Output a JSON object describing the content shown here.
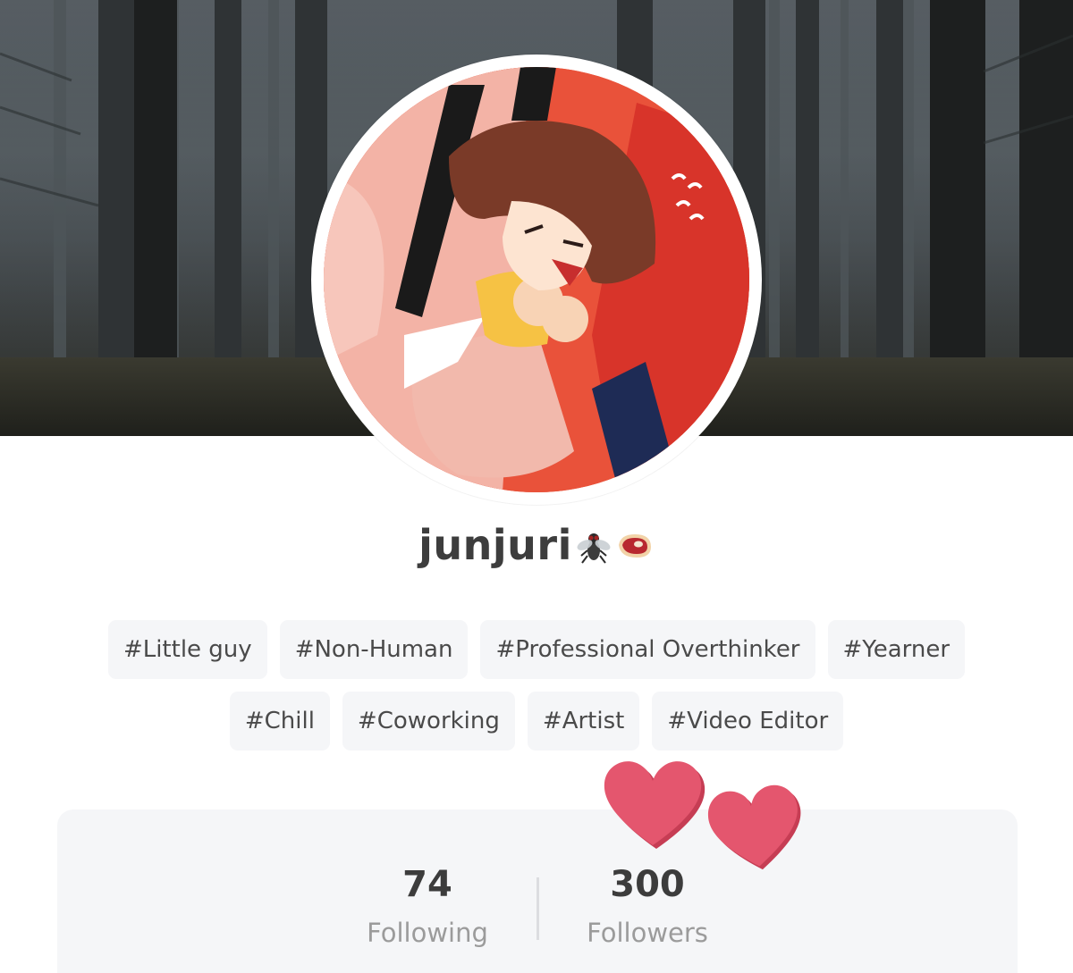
{
  "profile": {
    "username": "junjuri",
    "name_emojis": [
      "fly-icon",
      "meat-icon"
    ],
    "banner_image": "foggy-forest-banner",
    "avatar_image": "anime-character-avatar"
  },
  "tags": {
    "row1": [
      "#Little guy",
      "#Non-Human",
      "#Professional Overthinker",
      "#Yearner"
    ],
    "row2": [
      "#Chill",
      "#Coworking",
      "#Artist",
      "#Video Editor"
    ]
  },
  "stats": {
    "following_count": "74",
    "following_label": "Following",
    "followers_count": "300",
    "followers_label": "Followers"
  },
  "decorations": {
    "hearts_color": "#e4566e"
  }
}
